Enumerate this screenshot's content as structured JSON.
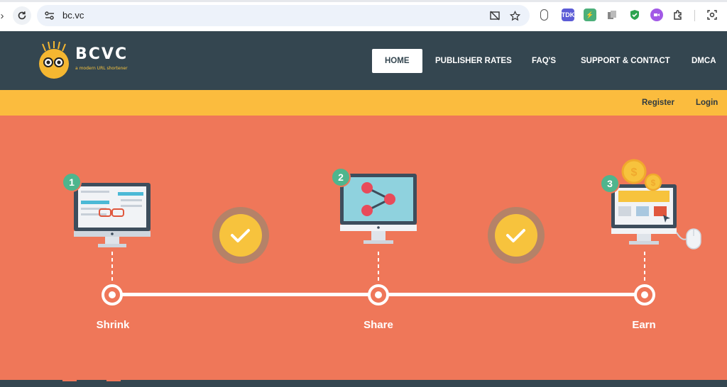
{
  "browser": {
    "url": "bc.vc",
    "extension_badge_text": "TDK"
  },
  "site": {
    "logo": {
      "name": "BCVC",
      "tagline": "a modern URL shortener"
    },
    "nav": [
      {
        "label": "HOME",
        "active": true
      },
      {
        "label": "PUBLISHER RATES",
        "active": false
      },
      {
        "label": "FAQ'S",
        "active": false
      },
      {
        "label": "SUPPORT & CONTACT",
        "active": false
      },
      {
        "label": "DMCA",
        "active": false
      }
    ],
    "auth": {
      "register": "Register",
      "login": "Login"
    }
  },
  "steps": [
    {
      "number": "1",
      "label": "Shrink"
    },
    {
      "number": "2",
      "label": "Share"
    },
    {
      "number": "3",
      "label": "Earn"
    }
  ],
  "colors": {
    "header": "#344650",
    "accent_yellow": "#fbbc3e",
    "hero": "#ef7759",
    "step_badge": "#4fb58d",
    "check_circle": "#f7c33d"
  }
}
